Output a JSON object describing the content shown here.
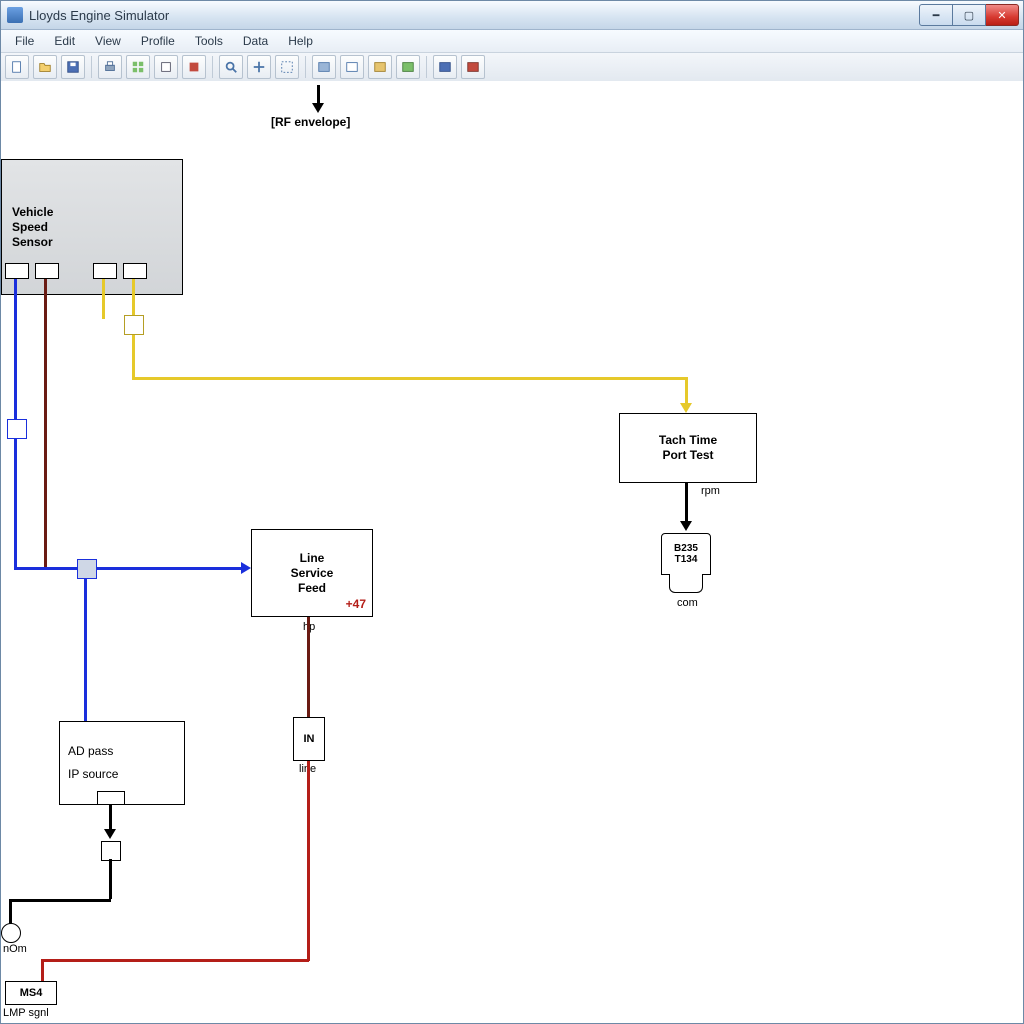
{
  "title": "Lloyds Engine Simulator",
  "menu": [
    "File",
    "Edit",
    "View",
    "Profile",
    "Tools",
    "Data",
    "Help"
  ],
  "canvas": {
    "top_label": "[RF envelope]",
    "blocks": {
      "vss": {
        "line1": "Vehicle",
        "line2": "Speed",
        "line3": "Sensor"
      },
      "tach": {
        "line1": "Tach Time",
        "line2": "Port Test"
      },
      "line_feed": {
        "line1": "Line",
        "line2": "Service",
        "line3": "Feed",
        "badge": "+47",
        "sub": "hp"
      },
      "ad_line1": "AD pass",
      "ad_line2": "IP source",
      "in_label": "IN",
      "in_sub": "line",
      "conn_line1": "B235",
      "conn_line2": "T134",
      "conn_sub": "com",
      "tach_sub": "rpm",
      "bottom_box": "MS4",
      "bottom_label": "LMP sgnl",
      "node_label": "nOm"
    }
  }
}
